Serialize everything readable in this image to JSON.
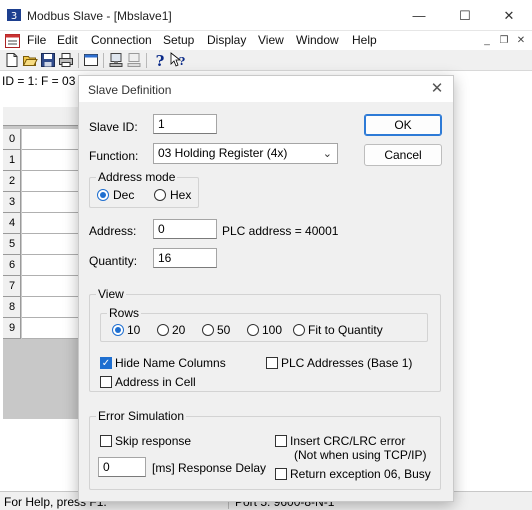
{
  "window": {
    "title": "Modbus Slave - [Mbslave1]",
    "controls": {
      "minimize": "—",
      "maximize": "☐",
      "close": "✕"
    }
  },
  "menu": [
    "File",
    "Edit",
    "Connection",
    "Setup",
    "Display",
    "View",
    "Window",
    "Help"
  ],
  "mdi_controls": {
    "minimize": "_",
    "restore": "❐",
    "close": "✕"
  },
  "toolbar": [
    "new-icon",
    "open-icon",
    "save-icon",
    "print-icon",
    "window-icon",
    "connect-icon",
    "disconnect-icon",
    "help-icon",
    "whats-this-icon"
  ],
  "document": {
    "info_line": "ID = 1: F = 03",
    "rows": [
      "0",
      "1",
      "2",
      "3",
      "4",
      "5",
      "6",
      "7",
      "8",
      "9"
    ]
  },
  "status": {
    "left": "For Help, press F1.",
    "port": "Port 5: 9600-8-N-1"
  },
  "dialog": {
    "title": "Slave Definition",
    "slave_id_label": "Slave ID:",
    "slave_id_value": "1",
    "function_label": "Function:",
    "function_value": "03 Holding Register (4x)",
    "ok": "OK",
    "cancel": "Cancel",
    "address_mode": {
      "title": "Address mode",
      "dec": "Dec",
      "hex": "Hex",
      "selected": "Dec"
    },
    "address_label": "Address:",
    "address_value": "0",
    "plc_address_text": "PLC address = 40001",
    "quantity_label": "Quantity:",
    "quantity_value": "16",
    "view": {
      "title": "View",
      "rows_title": "Rows",
      "rows_options": [
        "10",
        "20",
        "50",
        "100",
        "Fit to Quantity"
      ],
      "rows_selected": "10",
      "hide_name_columns": "Hide Name Columns",
      "hide_name_columns_checked": true,
      "plc_addresses": "PLC Addresses (Base 1)",
      "plc_addresses_checked": false,
      "address_in_cell": "Address in Cell",
      "address_in_cell_checked": false
    },
    "error_simulation": {
      "title": "Error Simulation",
      "skip_response": "Skip response",
      "insert_crc": "Insert CRC/LRC error",
      "insert_crc_note": "(Not when using TCP/IP)",
      "delay_value": "0",
      "delay_label": "[ms] Response Delay",
      "return_exception": "Return exception 06, Busy"
    }
  },
  "colors": {
    "accent": "#1f6fd0"
  }
}
